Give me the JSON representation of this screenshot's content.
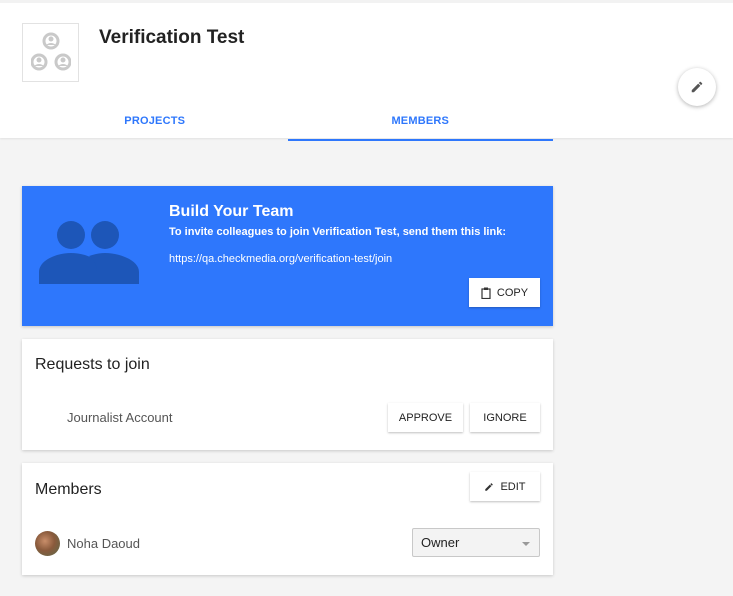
{
  "team": {
    "name": "Verification Test"
  },
  "tabs": [
    {
      "label": "PROJECTS",
      "active": false
    },
    {
      "label": "MEMBERS",
      "active": true
    }
  ],
  "banner": {
    "title": "Build Your Team",
    "subtitle": "To invite colleagues to join Verification Test, send them this link:",
    "link": "https://qa.checkmedia.org/verification-test/join",
    "copy_label": "COPY",
    "background": "#2e77fc"
  },
  "requests": {
    "title": "Requests to join",
    "items": [
      {
        "name": "Journalist Account",
        "approve_label": "APPROVE",
        "ignore_label": "IGNORE"
      }
    ]
  },
  "members": {
    "title": "Members",
    "edit_label": "EDIT",
    "items": [
      {
        "name": "Noha Daoud",
        "role": "Owner"
      }
    ]
  },
  "colors": {
    "accent": "#2e77fc"
  },
  "icons": [
    "team-avatar-icon",
    "pencil-icon",
    "people-icon",
    "clipboard-icon",
    "chevron-down-icon"
  ]
}
